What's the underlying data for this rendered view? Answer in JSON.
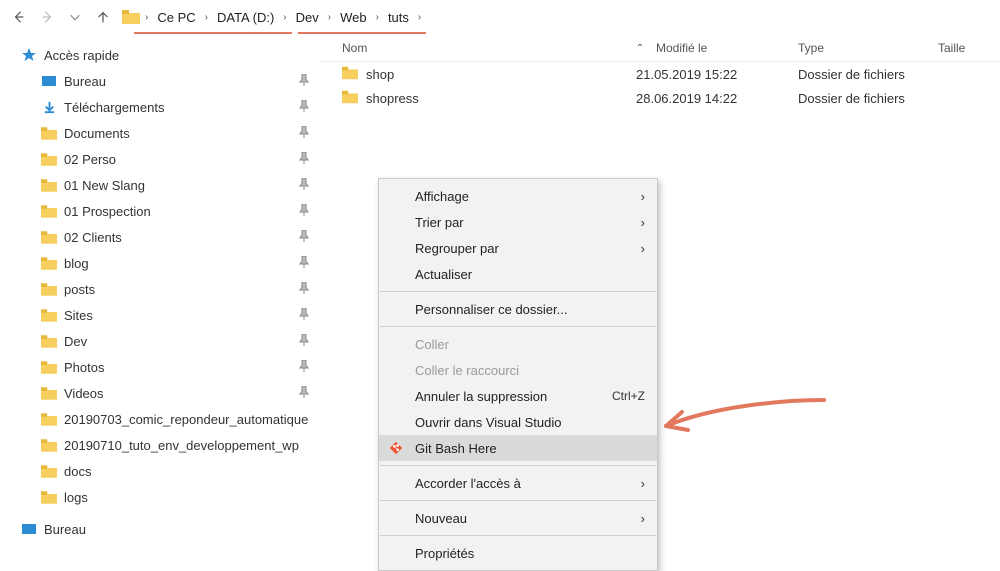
{
  "breadcrumb": {
    "segments": [
      "Ce PC",
      "DATA (D:)",
      "Dev",
      "Web",
      "tuts"
    ]
  },
  "sidebar": {
    "quick_access_label": "Accès rapide",
    "items": [
      {
        "label": "Bureau",
        "kind": "desktop",
        "pinned": true,
        "indent": 28
      },
      {
        "label": "Téléchargements",
        "kind": "download",
        "pinned": true,
        "indent": 28
      },
      {
        "label": "Documents",
        "kind": "folder",
        "pinned": true,
        "indent": 28
      },
      {
        "label": "02 Perso",
        "kind": "folder",
        "pinned": true,
        "indent": 28
      },
      {
        "label": "01 New Slang",
        "kind": "folder",
        "pinned": true,
        "indent": 28
      },
      {
        "label": "01 Prospection",
        "kind": "folder",
        "pinned": true,
        "indent": 28
      },
      {
        "label": "02 Clients",
        "kind": "folder",
        "pinned": true,
        "indent": 28
      },
      {
        "label": "blog",
        "kind": "folder",
        "pinned": true,
        "indent": 28
      },
      {
        "label": "posts",
        "kind": "folder",
        "pinned": true,
        "indent": 28
      },
      {
        "label": "Sites",
        "kind": "folder",
        "pinned": true,
        "indent": 28
      },
      {
        "label": "Dev",
        "kind": "folder",
        "pinned": true,
        "indent": 28
      },
      {
        "label": "Photos",
        "kind": "folder",
        "pinned": true,
        "indent": 28
      },
      {
        "label": "Videos",
        "kind": "folder",
        "pinned": true,
        "indent": 28
      },
      {
        "label": "20190703_comic_repondeur_automatique",
        "kind": "folder",
        "pinned": false,
        "indent": 28
      },
      {
        "label": "20190710_tuto_env_developpement_wp",
        "kind": "folder",
        "pinned": false,
        "indent": 28
      },
      {
        "label": "docs",
        "kind": "folder",
        "pinned": false,
        "indent": 28
      },
      {
        "label": "logs",
        "kind": "folder",
        "pinned": false,
        "indent": 28
      }
    ],
    "bottom_desktop_label": "Bureau"
  },
  "file_header": {
    "name": "Nom",
    "modified": "Modifié le",
    "type": "Type",
    "size": "Taille"
  },
  "files": [
    {
      "name": "shop",
      "modified": "21.05.2019 15:22",
      "type": "Dossier de fichiers"
    },
    {
      "name": "shopress",
      "modified": "28.06.2019 14:22",
      "type": "Dossier de fichiers"
    }
  ],
  "context_menu": {
    "items": [
      {
        "label": "Affichage",
        "submenu": true
      },
      {
        "label": "Trier par",
        "submenu": true
      },
      {
        "label": "Regrouper par",
        "submenu": true
      },
      {
        "label": "Actualiser"
      },
      {
        "sep": true
      },
      {
        "label": "Personnaliser ce dossier..."
      },
      {
        "sep": true
      },
      {
        "label": "Coller",
        "disabled": true
      },
      {
        "label": "Coller le raccourci",
        "disabled": true
      },
      {
        "label": "Annuler la suppression",
        "shortcut": "Ctrl+Z"
      },
      {
        "label": "Ouvrir dans Visual Studio"
      },
      {
        "label": "Git Bash Here",
        "icon": "git",
        "highlight": true
      },
      {
        "sep": true
      },
      {
        "label": "Accorder l'accès à",
        "submenu": true
      },
      {
        "sep": true
      },
      {
        "label": "Nouveau",
        "submenu": true
      },
      {
        "sep": true
      },
      {
        "label": "Propriétés"
      }
    ]
  }
}
